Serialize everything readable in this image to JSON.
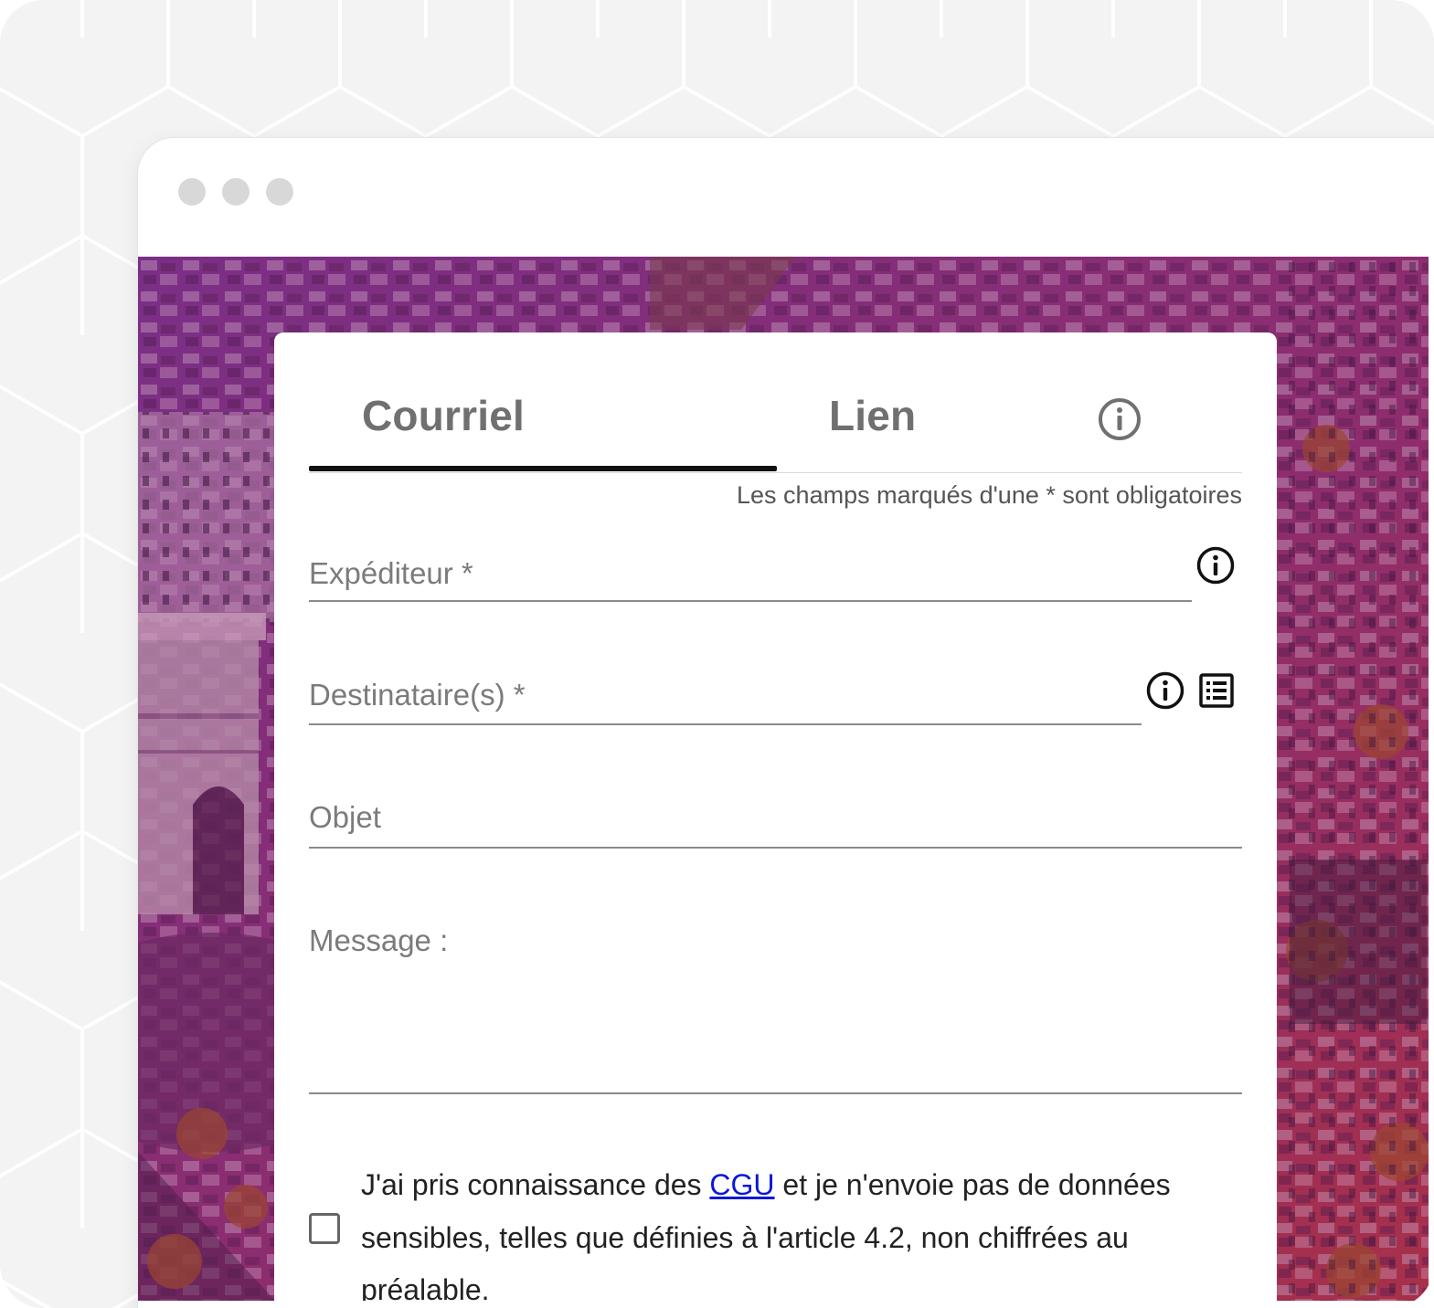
{
  "browser": {
    "window_controls": [
      "close",
      "minimize",
      "maximize"
    ]
  },
  "tabs": [
    {
      "label": "Courriel",
      "active": true
    },
    {
      "label": "Lien",
      "active": false
    }
  ],
  "tab_info_icon": "info-circle-icon",
  "required_note": "Les champs marqués d'une * sont obligatoires",
  "form": {
    "sender": {
      "label": "Expéditeur *",
      "icon": "info-circle-icon"
    },
    "recipients": {
      "label": "Destinataire(s) *",
      "icons": [
        "info-circle-icon",
        "contact-list-icon"
      ]
    },
    "subject": {
      "label": "Objet"
    },
    "message": {
      "label": "Message :"
    }
  },
  "consent": {
    "checked": false,
    "text_before": "J'ai pris connaissance des ",
    "link_text": "CGU",
    "text_after": " et je n'envoie pas de données sensibles, telles que définies à l'article 4.2, non chiffrées au préalable."
  },
  "colors": {
    "overlay": "#8a2d7a",
    "link": "#0a17d8",
    "tab_active_underline": "#111111"
  }
}
